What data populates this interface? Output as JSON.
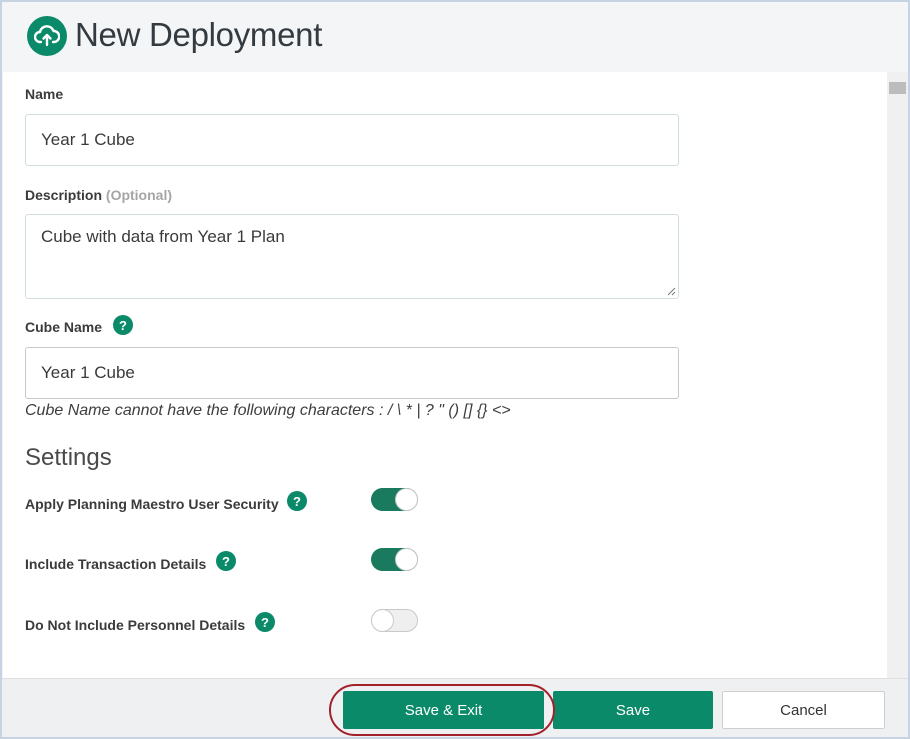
{
  "header": {
    "title": "New Deployment",
    "icon": "cloud-upload-icon"
  },
  "form": {
    "name": {
      "label": "Name",
      "value": "Year 1 Cube"
    },
    "description": {
      "label": "Description",
      "optional_tag": "(Optional)",
      "value": "Cube with data from Year 1 Plan"
    },
    "cube_name": {
      "label": "Cube Name",
      "value": "Year 1 Cube",
      "hint": "Cube Name cannot have the following characters : / \\ * | ? \" () [] {} <>"
    }
  },
  "settings": {
    "title": "Settings",
    "items": [
      {
        "label": "Apply Planning Maestro User Security",
        "enabled": true
      },
      {
        "label": "Include Transaction Details",
        "enabled": true
      },
      {
        "label": "Do Not Include Personnel Details",
        "enabled": false
      }
    ]
  },
  "help_glyph": "?",
  "footer": {
    "save_exit_label": "Save & Exit",
    "save_label": "Save",
    "cancel_label": "Cancel"
  },
  "colors": {
    "accent": "#0b8a6a",
    "highlight": "#a3212a"
  }
}
